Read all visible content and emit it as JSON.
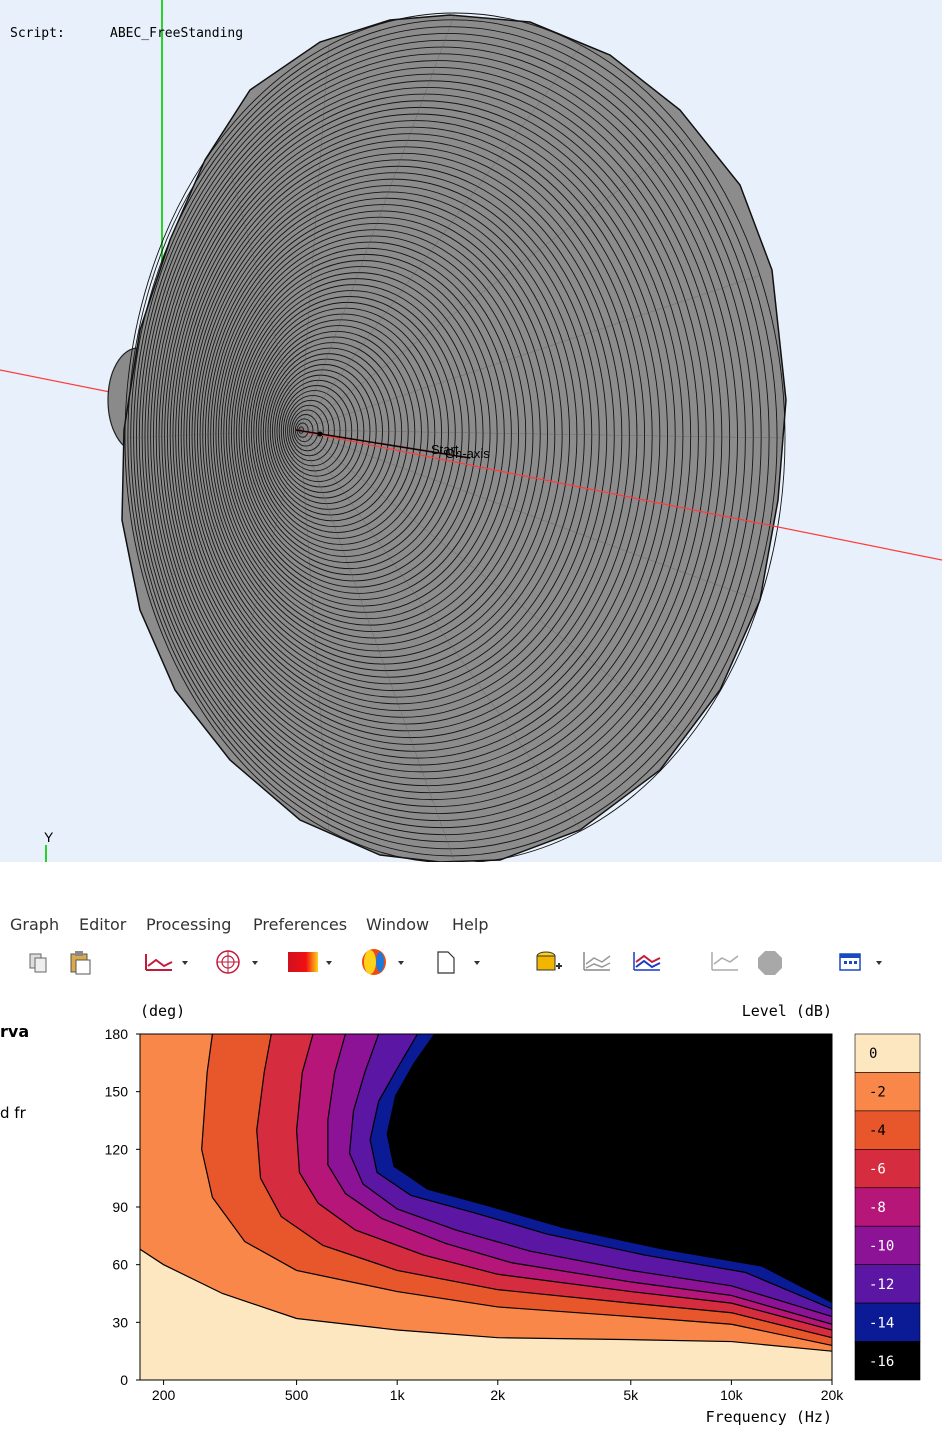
{
  "viewport": {
    "script_label": "Script:",
    "script_name": "ABEC_FreeStanding",
    "axis_y_label": "Y",
    "start_label": "Start",
    "onaxis_label": "On-axis"
  },
  "menu": [
    "Graph",
    "Editor",
    "Processing",
    "Preferences",
    "Window",
    "Help"
  ],
  "toolbar_icons": [
    "copy-icon",
    "paste-icon",
    "line-graph-icon",
    "polar-graph-icon",
    "contour-graph-icon",
    "balloon-graph-icon",
    "new-document-icon",
    "load-data-icon",
    "overlay-icon",
    "compare-graph-icon",
    "graph-settings-icon",
    "stop-icon",
    "window-layout-icon"
  ],
  "left_panel": {
    "line1": "rva",
    "line2": "d fr"
  },
  "colors": {
    "c0": "#fde7c1",
    "c2": "#f9874a",
    "c4": "#e8562b",
    "c6": "#d62c3f",
    "c8": "#b51677",
    "c10": "#8c1296",
    "c12": "#5b16a3",
    "c14": "#0b1b95",
    "c16": "#000000"
  },
  "chart_data": {
    "type": "heatmap",
    "ylabel": "(deg)",
    "xlabel": "Frequency  (Hz)",
    "colorbar_label": "Level  (dB)",
    "x_scale": "log",
    "xlim": [
      170,
      20000
    ],
    "ylim": [
      0,
      180
    ],
    "x_ticks": [
      {
        "value": 200,
        "label": "200"
      },
      {
        "value": 500,
        "label": "500"
      },
      {
        "value": 1000,
        "label": "1k"
      },
      {
        "value": 2000,
        "label": "2k"
      },
      {
        "value": 5000,
        "label": "5k"
      },
      {
        "value": 10000,
        "label": "10k"
      },
      {
        "value": 20000,
        "label": "20k"
      }
    ],
    "y_ticks": [
      {
        "value": 0,
        "label": "0"
      },
      {
        "value": 30,
        "label": "30"
      },
      {
        "value": 60,
        "label": "60"
      },
      {
        "value": 90,
        "label": "90"
      },
      {
        "value": 120,
        "label": "120"
      },
      {
        "value": 150,
        "label": "150"
      },
      {
        "value": 180,
        "label": "180"
      }
    ],
    "levels": [
      {
        "label": "0",
        "color": "#fde7c1"
      },
      {
        "label": "-2",
        "color": "#f9874a"
      },
      {
        "label": "-4",
        "color": "#e8562b"
      },
      {
        "label": "-6",
        "color": "#d62c3f"
      },
      {
        "label": "-8",
        "color": "#b51677"
      },
      {
        "label": "-10",
        "color": "#8c1296"
      },
      {
        "label": "-12",
        "color": "#5b16a3"
      },
      {
        "label": "-14",
        "color": "#0b1b95"
      },
      {
        "label": "-16",
        "color": "#000000"
      }
    ],
    "contours": [
      {
        "level": "-2",
        "points": [
          [
            170,
            68
          ],
          [
            200,
            60
          ],
          [
            300,
            45
          ],
          [
            500,
            32
          ],
          [
            1000,
            26
          ],
          [
            2000,
            22
          ],
          [
            5000,
            21
          ],
          [
            10000,
            20
          ],
          [
            20000,
            15
          ]
        ]
      },
      {
        "level": "-4",
        "points": [
          [
            280,
            180
          ],
          [
            270,
            160
          ],
          [
            260,
            120
          ],
          [
            280,
            95
          ],
          [
            350,
            72
          ],
          [
            500,
            57
          ],
          [
            1000,
            46
          ],
          [
            2000,
            38
          ],
          [
            5000,
            33
          ],
          [
            10000,
            29
          ],
          [
            20000,
            18
          ]
        ]
      },
      {
        "level": "-6",
        "points": [
          [
            420,
            180
          ],
          [
            400,
            160
          ],
          [
            380,
            130
          ],
          [
            390,
            105
          ],
          [
            450,
            85
          ],
          [
            600,
            70
          ],
          [
            1000,
            57
          ],
          [
            2000,
            47
          ],
          [
            5000,
            40
          ],
          [
            10000,
            35
          ],
          [
            20000,
            22
          ]
        ]
      },
      {
        "level": "-8",
        "points": [
          [
            560,
            180
          ],
          [
            520,
            160
          ],
          [
            500,
            130
          ],
          [
            510,
            108
          ],
          [
            580,
            92
          ],
          [
            750,
            78
          ],
          [
            1200,
            65
          ],
          [
            2000,
            55
          ],
          [
            5000,
            46
          ],
          [
            10000,
            40
          ],
          [
            20000,
            26
          ]
        ]
      },
      {
        "level": "-10",
        "points": [
          [
            700,
            180
          ],
          [
            650,
            160
          ],
          [
            620,
            135
          ],
          [
            620,
            112
          ],
          [
            700,
            97
          ],
          [
            900,
            84
          ],
          [
            1400,
            71
          ],
          [
            2200,
            61
          ],
          [
            5000,
            51
          ],
          [
            10000,
            44
          ],
          [
            20000,
            29
          ]
        ]
      },
      {
        "level": "-12",
        "points": [
          [
            880,
            180
          ],
          [
            800,
            160
          ],
          [
            740,
            140
          ],
          [
            720,
            118
          ],
          [
            790,
            102
          ],
          [
            1000,
            89
          ],
          [
            1500,
            78
          ],
          [
            2500,
            67
          ],
          [
            5000,
            57
          ],
          [
            10000,
            49
          ],
          [
            20000,
            33
          ]
        ]
      },
      {
        "level": "-14",
        "points": [
          [
            1150,
            180
          ],
          [
            1000,
            162
          ],
          [
            880,
            145
          ],
          [
            830,
            125
          ],
          [
            870,
            108
          ],
          [
            1100,
            96
          ],
          [
            1700,
            87
          ],
          [
            2800,
            76
          ],
          [
            5500,
            65
          ],
          [
            11000,
            56
          ],
          [
            20000,
            37
          ]
        ]
      }
    ]
  }
}
